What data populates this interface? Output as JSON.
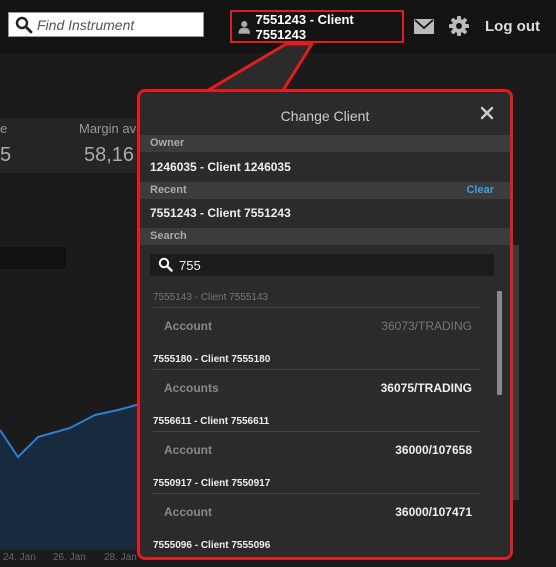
{
  "topbar": {
    "search_placeholder": "Find Instrument",
    "client_label": "7551243 - Client 7551243",
    "logout_label": "Log out"
  },
  "background": {
    "margin_label": "Margin av",
    "margin_value": "58,16",
    "edge_label": "e",
    "edge_value": "5",
    "axis_labels": [
      "24. Jan",
      "26. Jan",
      "28. Jan"
    ]
  },
  "dialog": {
    "title": "Change Client",
    "owner_label": "Owner",
    "owner_client": "1246035 - Client 1246035",
    "recent_label": "Recent",
    "clear_label": "Clear",
    "recent_client": "7551243 - Client 7551243",
    "search_label": "Search",
    "search_value": "755",
    "results": [
      {
        "name": "7555143 - Client 7555143",
        "label": "Account",
        "value": "36073/TRADING",
        "dim": true
      },
      {
        "name": "7555180 - Client 7555180",
        "label": "Accounts",
        "value": "36075/TRADING",
        "dim": false
      },
      {
        "name": "7556611 - Client 7556611",
        "label": "Account",
        "value": "36000/107658",
        "dim": false
      },
      {
        "name": "7550917 - Client 7550917",
        "label": "Account",
        "value": "36000/107471",
        "dim": false
      },
      {
        "name": "7555096 - Client 7555096",
        "label": "",
        "value": "",
        "dim": false
      }
    ]
  }
}
